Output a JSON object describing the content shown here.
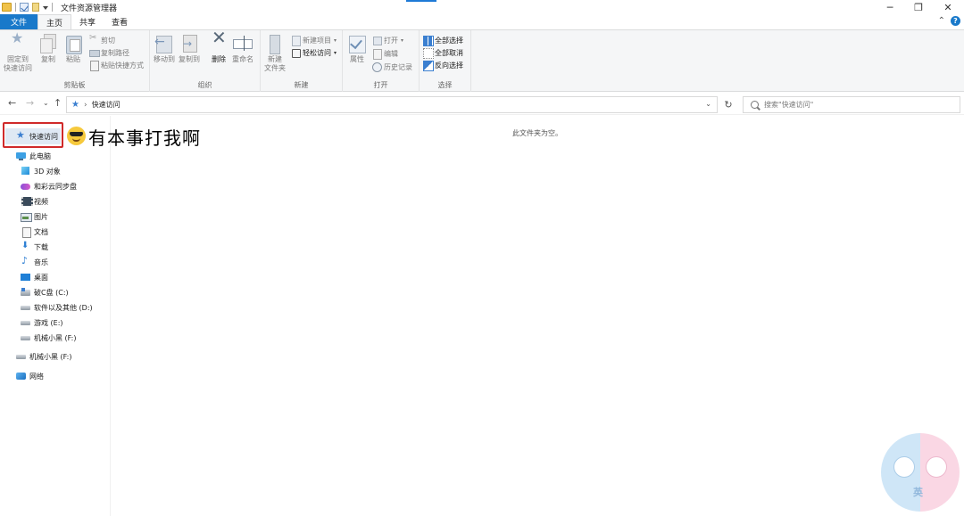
{
  "window": {
    "title": "文件资源管理器",
    "controls": {
      "minimize": "─",
      "maximize": "❐",
      "close": "✕"
    }
  },
  "ribbon_tabs": [
    {
      "label": "文件"
    },
    {
      "label": "主页"
    },
    {
      "label": "共享"
    },
    {
      "label": "查看"
    }
  ],
  "ribbon": {
    "clipboard": {
      "label": "剪贴板",
      "pin_line1": "固定到",
      "pin_line2": "快速访问",
      "copy": "复制",
      "paste": "粘贴",
      "cut": "剪切",
      "copy_path": "复制路径",
      "paste_shortcut": "粘贴快捷方式"
    },
    "organize": {
      "label": "组织",
      "move_to": "移动到",
      "copy_to": "复制到",
      "delete": "删除",
      "rename": "重命名"
    },
    "new": {
      "label": "新建",
      "new_folder_line1": "新建",
      "new_folder_line2": "文件夹",
      "new_item": "新建项目",
      "easy_access": "轻松访问"
    },
    "open": {
      "label": "打开",
      "properties": "属性",
      "open": "打开",
      "edit": "编辑",
      "history": "历史记录"
    },
    "select": {
      "label": "选择",
      "select_all": "全部选择",
      "select_none": "全部取消",
      "invert": "反向选择"
    }
  },
  "address": {
    "path": "快速访问",
    "search_placeholder": "搜索\"快速访问\""
  },
  "nav": {
    "quick_access": "快速访问",
    "this_pc": "此电脑",
    "items": [
      {
        "label": "3D 对象",
        "icon": "cube-icon"
      },
      {
        "label": "和彩云同步盘",
        "icon": "cloud-icon"
      },
      {
        "label": "视频",
        "icon": "video-icon"
      },
      {
        "label": "图片",
        "icon": "pictures-icon"
      },
      {
        "label": "文档",
        "icon": "documents-icon"
      },
      {
        "label": "下载",
        "icon": "download-icon"
      },
      {
        "label": "音乐",
        "icon": "music-icon"
      },
      {
        "label": "桌面",
        "icon": "desktop-icon"
      },
      {
        "label": "破C盘 (C:)",
        "icon": "drive-icon"
      },
      {
        "label": "软件以及其他 (D:)",
        "icon": "drive-icon"
      },
      {
        "label": "游戏 (E:)",
        "icon": "drive-icon"
      },
      {
        "label": "机械小黑 (F:)",
        "icon": "drive-icon"
      }
    ],
    "removable": "机械小黑 (F:)",
    "network": "网络"
  },
  "content": {
    "empty_message": "此文件夹为空。"
  },
  "overlay": {
    "caption": "有本事打我啊"
  },
  "watermark": {
    "text": "英"
  },
  "colors": {
    "accent": "#1979ca",
    "highlight_box": "#d02a2a"
  }
}
